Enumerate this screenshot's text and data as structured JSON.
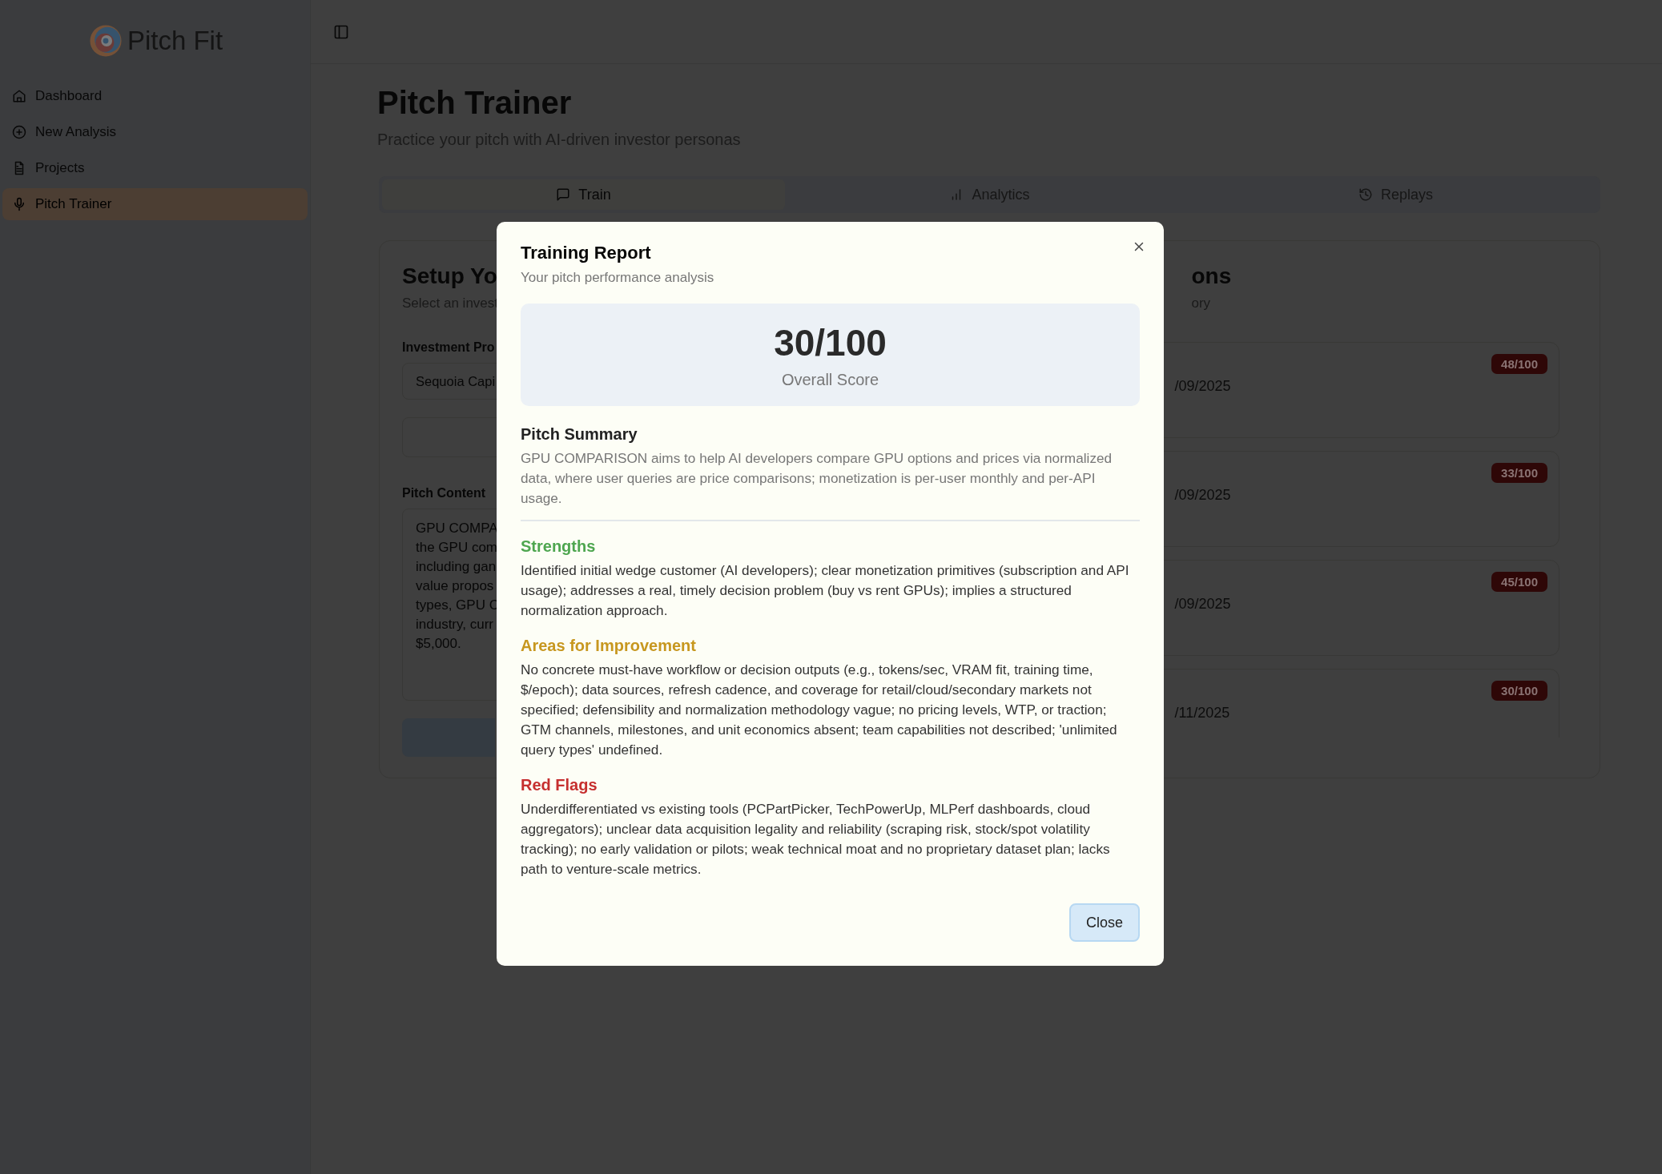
{
  "sidebar": {
    "logo_text": "Pitch Fit",
    "items": [
      {
        "label": "Dashboard",
        "selected": false
      },
      {
        "label": "New Analysis",
        "selected": false
      },
      {
        "label": "Projects",
        "selected": false
      },
      {
        "label": "Pitch Trainer",
        "selected": true
      }
    ]
  },
  "header": {
    "title": "Pitch Trainer",
    "subtitle": "Practice your pitch with AI-driven investor personas"
  },
  "tabs": [
    {
      "label": "Train",
      "selected": true
    },
    {
      "label": "Analytics",
      "selected": false
    },
    {
      "label": "Replays",
      "selected": false
    }
  ],
  "setup_card": {
    "title": "Setup Yo",
    "subtitle": "Select an invest",
    "profile_label": "Investment Pro",
    "profile_value": "Sequoia Capi",
    "pitch_label": "Pitch Content",
    "pitch_lines": [
      "GPU COMPA",
      "the GPU com",
      "including gan",
      "value propos",
      "types, GPU C",
      "industry, curr",
      "$5,000."
    ]
  },
  "sessions_card": {
    "title": "ons",
    "subtitle": "ory",
    "sessions": [
      {
        "date": "/09/2025",
        "score": "48/100"
      },
      {
        "date": "/09/2025",
        "score": "33/100"
      },
      {
        "date": "/09/2025",
        "score": "45/100"
      },
      {
        "date": "/11/2025",
        "score": "30/100"
      }
    ]
  },
  "modal": {
    "title": "Training Report",
    "subtitle": "Your pitch performance analysis",
    "score": "30/100",
    "score_label": "Overall Score",
    "summary_heading": "Pitch Summary",
    "summary": "GPU COMPARISON aims to help AI developers compare GPU options and prices via normalized data, where user queries are price comparisons; monetization is per-user monthly and per-API usage.",
    "sections": [
      {
        "kind": "strengths",
        "heading": "Strengths",
        "text": "Identified initial wedge customer (AI developers); clear monetization primitives (subscription and API usage); addresses a real, timely decision problem (buy vs rent GPUs); implies a structured normalization approach."
      },
      {
        "kind": "improvement",
        "heading": "Areas for Improvement",
        "text": "No concrete must-have workflow or decision outputs (e.g., tokens/sec, VRAM fit, training time, $/epoch); data sources, refresh cadence, and coverage for retail/cloud/secondary markets not specified; defensibility and normalization methodology vague; no pricing levels, WTP, or traction; GTM channels, milestones, and unit economics absent; team capabilities not described; 'unlimited query types' undefined."
      },
      {
        "kind": "red_flags",
        "heading": "Red Flags",
        "text": "Underdifferentiated vs existing tools (PCPartPicker, TechPowerUp, MLPerf dashboards, cloud aggregators); unclear data acquisition legality and reliability (scraping risk, stock/spot volatility tracking); no early validation or pilots; weak technical moat and no proprietary dataset plan; lacks path to venture-scale metrics."
      }
    ],
    "close_label": "Close"
  }
}
